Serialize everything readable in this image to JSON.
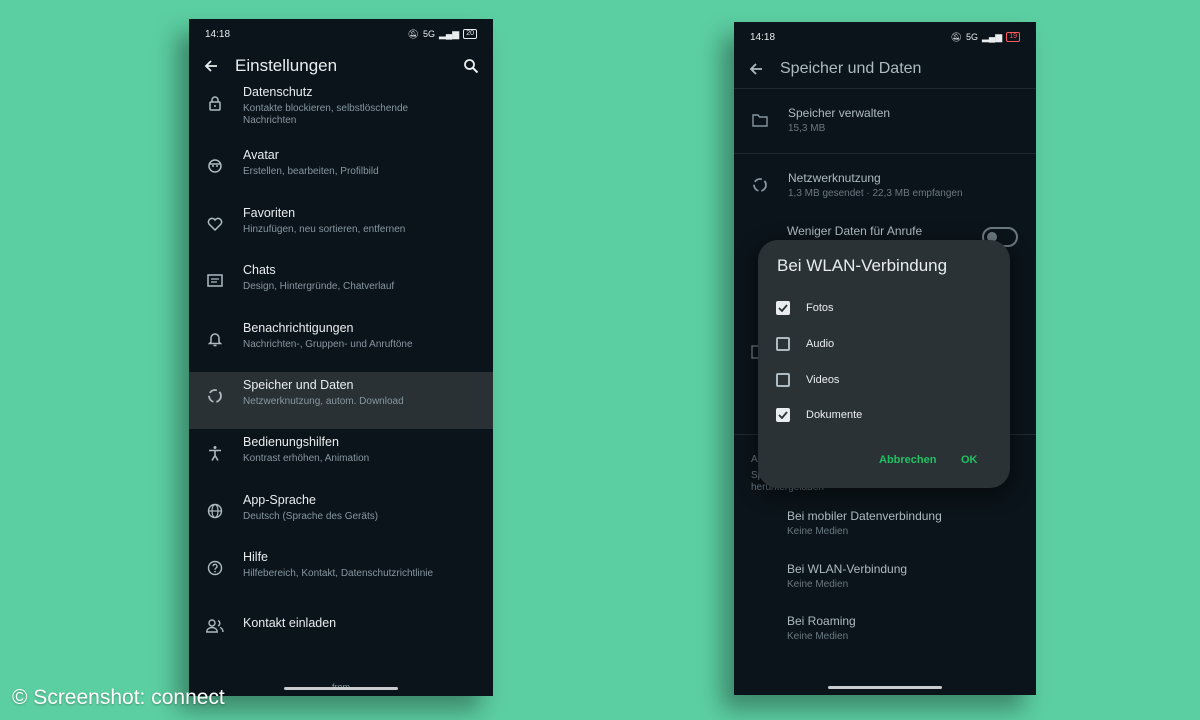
{
  "left_phone": {
    "status_time": "14:18",
    "status_net": "5G",
    "battery": "20",
    "title": "Einstellungen",
    "menu": [
      {
        "label": "Datenschutz",
        "sub": "Kontakte blockieren, selbstlöschende Nachrichten",
        "icon": "lock-icon"
      },
      {
        "label": "Avatar",
        "sub": "Erstellen, bearbeiten, Profilbild",
        "icon": "avatar-icon"
      },
      {
        "label": "Favoriten",
        "sub": "Hinzufügen, neu sortieren, entfernen",
        "icon": "heart-icon"
      },
      {
        "label": "Chats",
        "sub": "Design, Hintergründe, Chatverlauf",
        "icon": "chat-icon"
      },
      {
        "label": "Benachrichtigungen",
        "sub": "Nachrichten-, Gruppen- und Anruftöne",
        "icon": "bell-icon"
      },
      {
        "label": "Speicher und Daten",
        "sub": "Netzwerknutzung, autom. Download",
        "icon": "data-usage-icon"
      },
      {
        "label": "Bedienungshilfen",
        "sub": "Kontrast erhöhen, Animation",
        "icon": "accessibility-icon"
      },
      {
        "label": "App-Sprache",
        "sub": "Deutsch (Sprache des Geräts)",
        "icon": "globe-icon"
      },
      {
        "label": "Hilfe",
        "sub": "Hilfebereich, Kontakt, Datenschutzrichtlinie",
        "icon": "help-icon"
      },
      {
        "label": "Kontakt einladen",
        "sub": "",
        "icon": "invite-icon"
      }
    ],
    "footer": "from"
  },
  "right_phone": {
    "status_time": "14:18",
    "status_net": "5G",
    "battery": "19",
    "title": "Speicher und Daten",
    "items": {
      "manage_label": "Speicher verwalten",
      "manage_sub": "15,3 MB",
      "network_label": "Netzwerknutzung",
      "network_sub": "1,3 MB gesendet · 22,3 MB empfangen",
      "less_data_label": "Weniger Daten für Anrufe",
      "partial_a": "A",
      "partial_sp": "Sp",
      "partial_runter": "heruntergeladen",
      "mobile_label": "Bei mobiler Datenverbindung",
      "mobile_sub": "Keine Medien",
      "wlan_label": "Bei WLAN-Verbindung",
      "wlan_sub": "Keine Medien",
      "roaming_label": "Bei Roaming",
      "roaming_sub": "Keine Medien"
    },
    "dialog": {
      "title": "Bei WLAN-Verbindung",
      "options": [
        {
          "label": "Fotos",
          "checked": true
        },
        {
          "label": "Audio",
          "checked": false
        },
        {
          "label": "Videos",
          "checked": false
        },
        {
          "label": "Dokumente",
          "checked": true
        }
      ],
      "cancel": "Abbrechen",
      "ok": "OK"
    }
  },
  "credit": "© Screenshot: connect",
  "colors": {
    "background": "#5ccfa2",
    "phone_bg": "#0b141a",
    "accent": "#21c063"
  }
}
